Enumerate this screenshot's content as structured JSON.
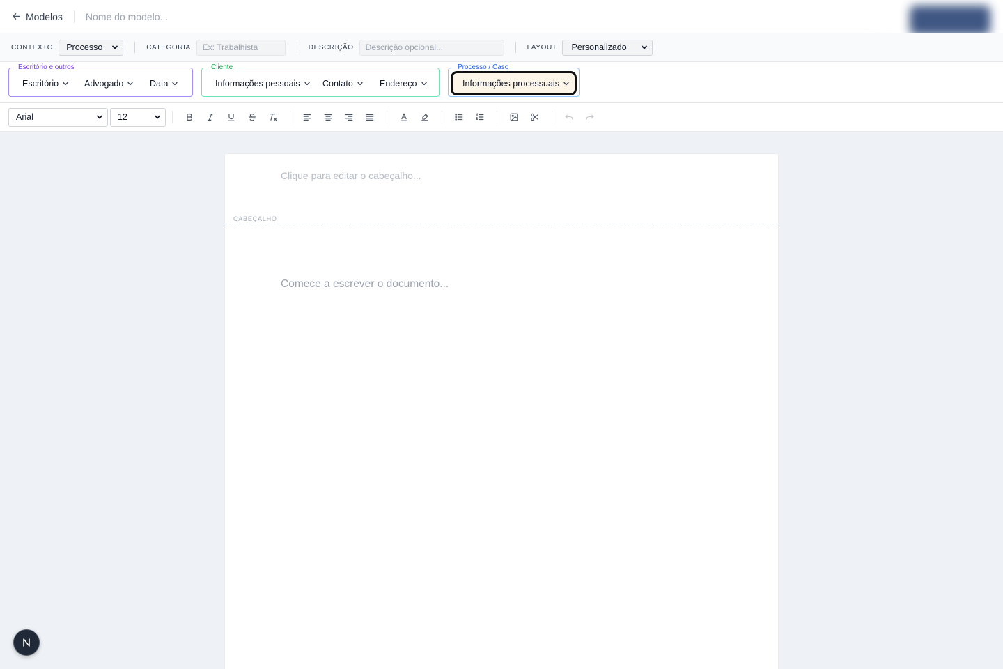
{
  "header": {
    "back_label": "Modelos",
    "name_placeholder": "Nome do modelo..."
  },
  "meta": {
    "context_label": "CONTEXTO",
    "context_value": "Processo",
    "category_label": "CATEGORIA",
    "category_placeholder": "Ex: Trabalhista",
    "description_label": "DESCRIÇÃO",
    "description_placeholder": "Descrição opcional...",
    "layout_label": "LAYOUT",
    "layout_value": "Personalizado"
  },
  "groups": {
    "office": {
      "legend": "Escritório e outros",
      "color": "#7c3aed",
      "items": [
        "Escritório",
        "Advogado",
        "Data"
      ]
    },
    "client": {
      "legend": "Cliente",
      "color": "#16a34a",
      "items": [
        "Informações pessoais",
        "Contato",
        "Endereço"
      ]
    },
    "process": {
      "legend": "Processo / Caso",
      "color": "#2563eb",
      "items": [
        "Informações processuais"
      ]
    }
  },
  "toolbar": {
    "font_family": "Arial",
    "font_size": "12",
    "icons": [
      "bold-icon",
      "italic-icon",
      "underline-icon",
      "strikethrough-icon",
      "clear-format-icon",
      "align-left-icon",
      "align-center-icon",
      "align-right-icon",
      "align-justify-icon",
      "text-color-icon",
      "highlight-icon",
      "bullet-list-icon",
      "numbered-list-icon",
      "image-icon",
      "scissors-icon",
      "undo-icon",
      "redo-icon"
    ]
  },
  "document": {
    "header_placeholder": "Clique para editar o cabeçalho...",
    "header_tag": "CABEÇALHO",
    "body_placeholder": "Comece a escrever o documento..."
  },
  "badge": {
    "letter": "N"
  }
}
